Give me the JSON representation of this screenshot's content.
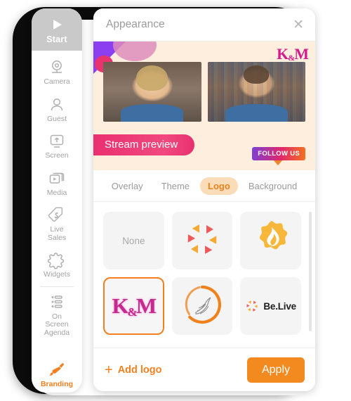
{
  "colors": {
    "accent_orange": "#f28020",
    "apply_button": "#f28a20",
    "tab_active_bg": "#fbdcb8",
    "preview_bg": "#fdeedd",
    "brand_magenta": "#d61a8c",
    "stream_banner_pink": "#ea2f70",
    "rail_start_bg": "#c9c9c9",
    "muted_text": "#a2a2a2"
  },
  "sidebar": {
    "start": {
      "label": "Start",
      "icon": "play-icon"
    },
    "items": [
      {
        "label": "Camera",
        "icon": "webcam-icon",
        "active": false
      },
      {
        "label": "Guest",
        "icon": "person-icon",
        "active": false
      },
      {
        "label": "Screen",
        "icon": "screen-share-icon",
        "active": false
      },
      {
        "label": "Media",
        "icon": "media-stack-icon",
        "active": false
      },
      {
        "label": "Live\nSales",
        "icon": "price-tag-icon",
        "active": false
      },
      {
        "label": "Widgets",
        "icon": "puzzle-icon",
        "active": false
      },
      {
        "label": "On\nScreen\nAgenda",
        "icon": "list-icon",
        "active": false
      },
      {
        "label": "Branding",
        "icon": "paintbrush-icon",
        "active": true
      }
    ]
  },
  "panel": {
    "header": {
      "title": "Appearance",
      "close_label": "✕",
      "close_icon": "close-icon"
    },
    "preview": {
      "brand_mark_left": "K",
      "brand_mark_amp": "&",
      "brand_mark_right": "M",
      "stream_banner": "Stream preview",
      "follow_badge": "FOLLOW US",
      "participants": [
        {
          "name": "participant-woman"
        },
        {
          "name": "participant-man"
        }
      ]
    },
    "tabs": [
      {
        "label": "Overlay",
        "active": false
      },
      {
        "label": "Theme",
        "active": false
      },
      {
        "label": "Logo",
        "active": true
      },
      {
        "label": "Background",
        "active": false
      }
    ],
    "logos": [
      {
        "id": "none",
        "label": "None",
        "type": "text",
        "selected": false
      },
      {
        "id": "pinwheel",
        "label": "",
        "type": "pinwheel-logo",
        "selected": false
      },
      {
        "id": "flame-badge",
        "label": "",
        "type": "flame-badge-logo",
        "selected": false
      },
      {
        "id": "km",
        "label": "K&M",
        "type": "km-logo",
        "selected": true
      },
      {
        "id": "bird-circle",
        "label": "",
        "type": "bird-circle-logo",
        "selected": false
      },
      {
        "id": "belive",
        "label": "Be.Live",
        "type": "belive-logo",
        "selected": false
      }
    ],
    "footer": {
      "add_logo_plus": "+",
      "add_logo_label": "Add logo",
      "apply_label": "Apply"
    }
  }
}
